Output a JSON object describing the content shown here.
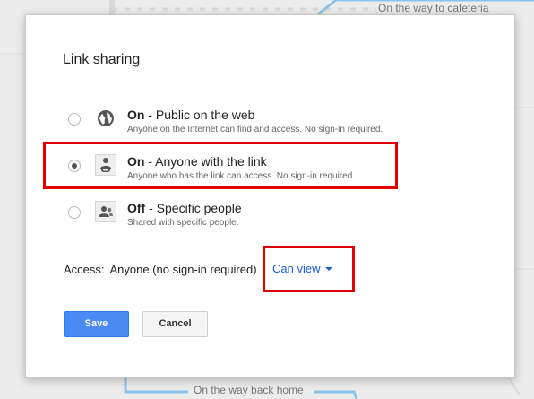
{
  "background": {
    "map_label_top": "On the way to cafeteria",
    "map_label_bottom": "On the way back home"
  },
  "dialog": {
    "title": "Link sharing",
    "options": [
      {
        "state": "On",
        "desc": "Public on the web",
        "sub": "Anyone on the Internet can find and access. No sign-in required.",
        "icon": "globe-icon",
        "selected": false
      },
      {
        "state": "On",
        "desc": "Anyone with the link",
        "sub": "Anyone who has the link can access. No sign-in required.",
        "icon": "link-person-icon",
        "selected": true
      },
      {
        "state": "Off",
        "desc": "Specific people",
        "sub": "Shared with specific people.",
        "icon": "people-icon",
        "selected": false
      }
    ],
    "access_label": "Access:",
    "access_value": "Anyone (no sign-in required)",
    "permission": "Can view",
    "save_label": "Save",
    "cancel_label": "Cancel"
  },
  "colors": {
    "accent": "#1a5ecf",
    "save_button": "#4a8af4",
    "highlight": "#e00000"
  }
}
